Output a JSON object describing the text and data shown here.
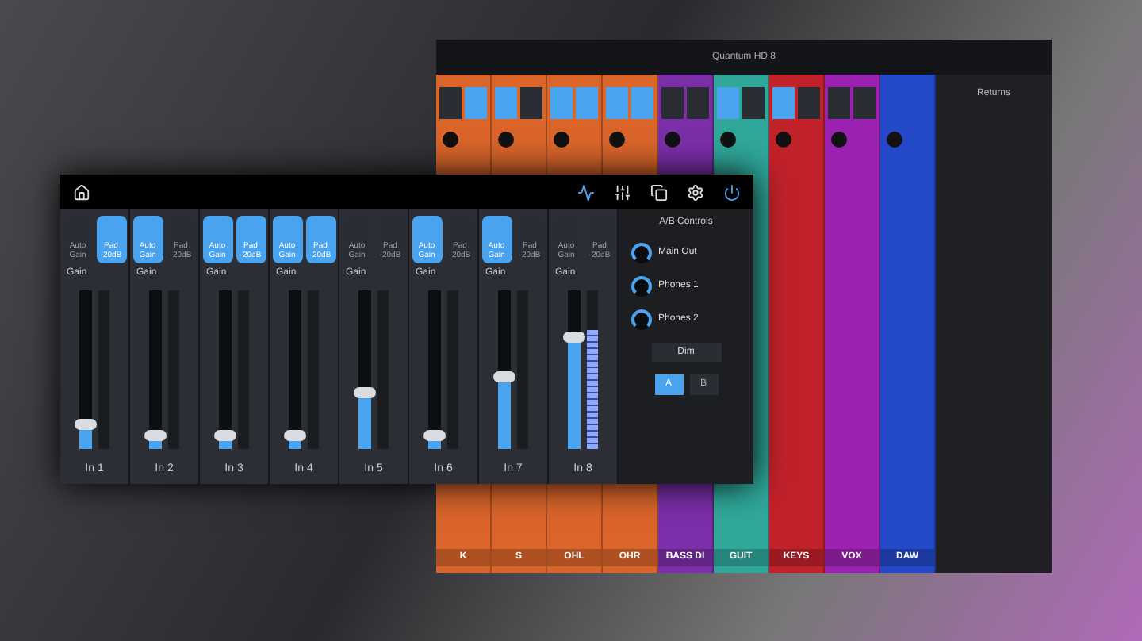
{
  "back_window": {
    "title": "Quantum HD 8",
    "channels": [
      {
        "name": "K",
        "color": "#d9652b",
        "auto_gain": false,
        "pad": true
      },
      {
        "name": "S",
        "color": "#d9652b",
        "auto_gain": true,
        "pad": false
      },
      {
        "name": "OHL",
        "color": "#d9652b",
        "auto_gain": true,
        "pad": true
      },
      {
        "name": "OHR",
        "color": "#d9652b",
        "auto_gain": true,
        "pad": true
      },
      {
        "name": "BASS DI",
        "color": "#7b2fa8",
        "auto_gain": false,
        "pad": false
      },
      {
        "name": "GUIT",
        "color": "#2fa89a",
        "auto_gain": true,
        "pad": false
      },
      {
        "name": "KEYS",
        "color": "#c0222a",
        "auto_gain": true,
        "pad": false
      },
      {
        "name": "VOX",
        "color": "#9b22b0",
        "auto_gain": false,
        "pad": false
      },
      {
        "name": "DAW",
        "color": "#2348c8"
      }
    ],
    "returns_title": "Returns"
  },
  "front_window": {
    "channels": [
      {
        "name": "In 1",
        "auto_gain_label": "Auto Gain",
        "pad_label": "Pad -20dB",
        "gain_label": "Gain",
        "auto_gain": false,
        "pad": true,
        "level": 0.15
      },
      {
        "name": "In 2",
        "auto_gain_label": "Auto Gain",
        "pad_label": "Pad -20dB",
        "gain_label": "Gain",
        "auto_gain": true,
        "pad": false,
        "level": 0.08
      },
      {
        "name": "In 3",
        "auto_gain_label": "Auto Gain",
        "pad_label": "Pad -20dB",
        "gain_label": "Gain",
        "auto_gain": true,
        "pad": true,
        "level": 0.08
      },
      {
        "name": "In 4",
        "auto_gain_label": "Auto Gain",
        "pad_label": "Pad -20dB",
        "gain_label": "Gain",
        "auto_gain": true,
        "pad": true,
        "level": 0.08
      },
      {
        "name": "In 5",
        "auto_gain_label": "Auto Gain",
        "pad_label": "Pad -20dB",
        "gain_label": "Gain",
        "auto_gain": false,
        "pad": false,
        "level": 0.35
      },
      {
        "name": "In 6",
        "auto_gain_label": "Auto Gain",
        "pad_label": "Pad -20dB",
        "gain_label": "Gain",
        "auto_gain": true,
        "pad": false,
        "level": 0.08
      },
      {
        "name": "In 7",
        "auto_gain_label": "Auto Gain",
        "pad_label": "Pad -20dB",
        "gain_label": "Gain",
        "auto_gain": true,
        "pad": false,
        "level": 0.45
      },
      {
        "name": "In 8",
        "auto_gain_label": "Auto Gain",
        "pad_label": "Pad -20dB",
        "gain_label": "Gain",
        "auto_gain": false,
        "pad": false,
        "level": 0.7,
        "meter": {
          "level": 0.75
        }
      }
    ],
    "panel": {
      "title": "A/B Controls",
      "knobs": [
        {
          "name": "Main Out"
        },
        {
          "name": "Phones 1"
        },
        {
          "name": "Phones 2"
        }
      ],
      "dim": "Dim",
      "ab": [
        {
          "label": "A",
          "selected": true
        },
        {
          "label": "B",
          "selected": false
        }
      ]
    }
  }
}
